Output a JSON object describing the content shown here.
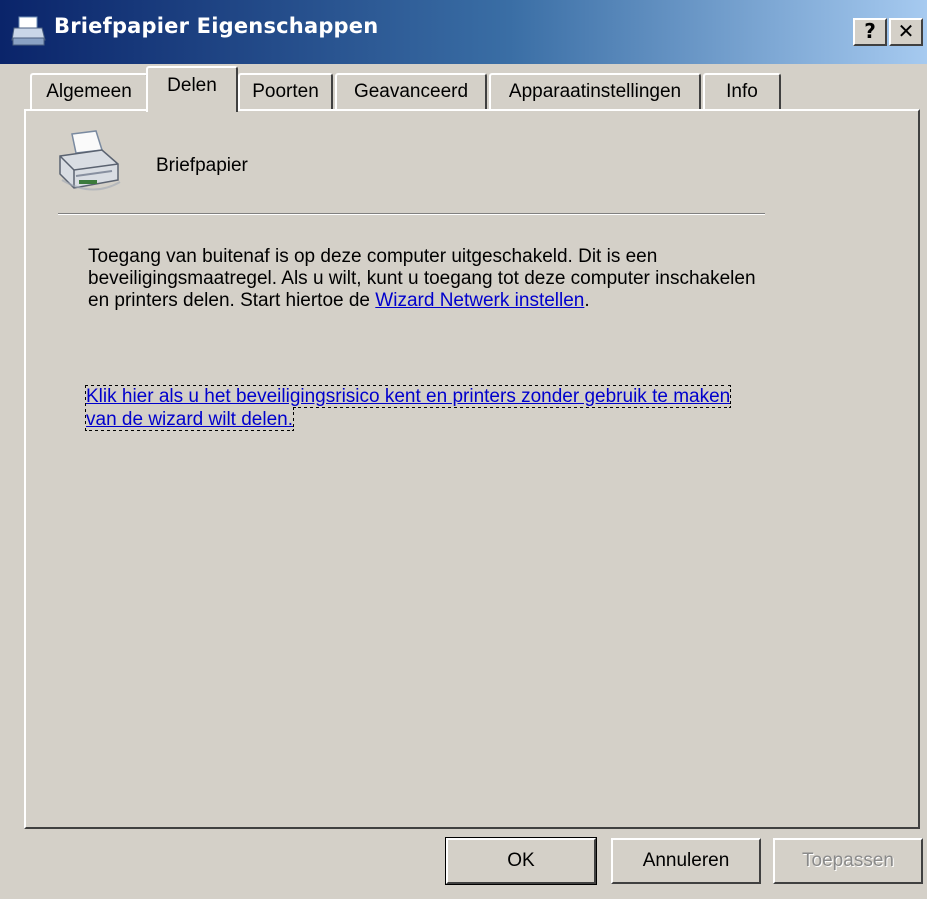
{
  "window": {
    "title": "Briefpapier Eigenschappen",
    "help_label": "?",
    "close_label": "✕"
  },
  "tabs": [
    {
      "label": "Algemeen",
      "active": false
    },
    {
      "label": "Delen",
      "active": true
    },
    {
      "label": "Poorten",
      "active": false
    },
    {
      "label": "Geavanceerd",
      "active": false
    },
    {
      "label": "Apparaatinstellingen",
      "active": false
    },
    {
      "label": "Info",
      "active": false
    }
  ],
  "printer": {
    "name": "Briefpapier",
    "icon": "printer-icon"
  },
  "message": {
    "text": "Toegang van buitenaf is op deze computer uitgeschakeld. Dit is een beveiligingsmaatregel. Als u wilt, kunt u toegang tot deze computer inschakelen en printers delen. Start hiertoe de ",
    "link": "Wizard Netwerk instellen",
    "after": "."
  },
  "risk_link": "Klik hier als u het beveiligingsrisico kent en printers zonder gebruik te maken van de wizard wilt delen.",
  "buttons": {
    "ok": "OK",
    "cancel": "Annuleren",
    "apply": "Toepassen"
  },
  "colors": {
    "title_start": "#0a246a",
    "title_end": "#a6caf0",
    "dialog_bg": "#d4d0c8",
    "link": "#0000cc"
  }
}
